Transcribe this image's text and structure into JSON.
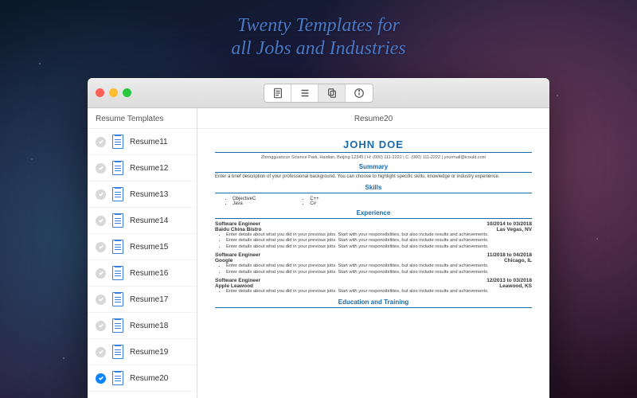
{
  "tagline": {
    "line1": "Twenty Templates for",
    "line2": "all Jobs and Industries"
  },
  "toolbar": {
    "icons": [
      "resume-page-icon",
      "list-icon",
      "copy-icon",
      "info-icon"
    ],
    "selected_index": 2
  },
  "sidebar": {
    "title": "Resume Templates",
    "items": [
      {
        "label": "Resume11",
        "selected": false
      },
      {
        "label": "Resume12",
        "selected": false
      },
      {
        "label": "Resume13",
        "selected": false
      },
      {
        "label": "Resume14",
        "selected": false
      },
      {
        "label": "Resume15",
        "selected": false
      },
      {
        "label": "Resume16",
        "selected": false
      },
      {
        "label": "Resume17",
        "selected": false
      },
      {
        "label": "Resume18",
        "selected": false
      },
      {
        "label": "Resume19",
        "selected": false
      },
      {
        "label": "Resume20",
        "selected": true
      }
    ]
  },
  "content": {
    "header": "Resume20",
    "resume": {
      "name": "JOHN DOE",
      "contact": "Zhongguancun Science Park, Haidian, Beijing 12345 | H: (000) 111-2222 | C: (000) 111-2222 | yourmail@icould.com",
      "summary_title": "Summary",
      "summary_text": "Enter a brief description of your professional background. You can choose to highlight specific skills, knowledge or industry experience.",
      "skills_title": "Skills",
      "skills_left": [
        "ObjectiveC",
        "Java"
      ],
      "skills_right": [
        "C++",
        "C#"
      ],
      "experience_title": "Experience",
      "jobs": [
        {
          "title": "Software Engineer",
          "dates": "10/2014 to 03/2018",
          "company": "Baidu China Bistro",
          "location": "Las Vegas, NV",
          "bullets": [
            "Enter details about what you did in your previous jobs. Start with your responsibilities, but also include results and achievements.",
            "Enter details about what you did in your previous jobs. Start with your responsibilities, but also include results and achievements.",
            "Enter details about what you did in your previous jobs. Start with your responsibilities, but also include results and achievements."
          ]
        },
        {
          "title": "Software Engineer",
          "dates": "11/2018 to 04/2018",
          "company": "Google",
          "location": "Chicago, IL",
          "bullets": [
            "Enter details about what you did in your previous jobs. Start with your responsibilities, but also include results and achievements.",
            "Enter details about what you did in your previous jobs. Start with your responsibilities, but also include results and achievements."
          ]
        },
        {
          "title": "Software Engineer",
          "dates": "12/2013 to 03/2018",
          "company": "Apple Leawood",
          "location": "Leawood, KS",
          "bullets": [
            "Enter details about what you did in your previous jobs. Start with your responsibilities, but also include results and achievements."
          ]
        }
      ],
      "education_title": "Education and Training"
    }
  },
  "colors": {
    "accent": "#1a6aa8",
    "selection": "#0a84ff"
  }
}
